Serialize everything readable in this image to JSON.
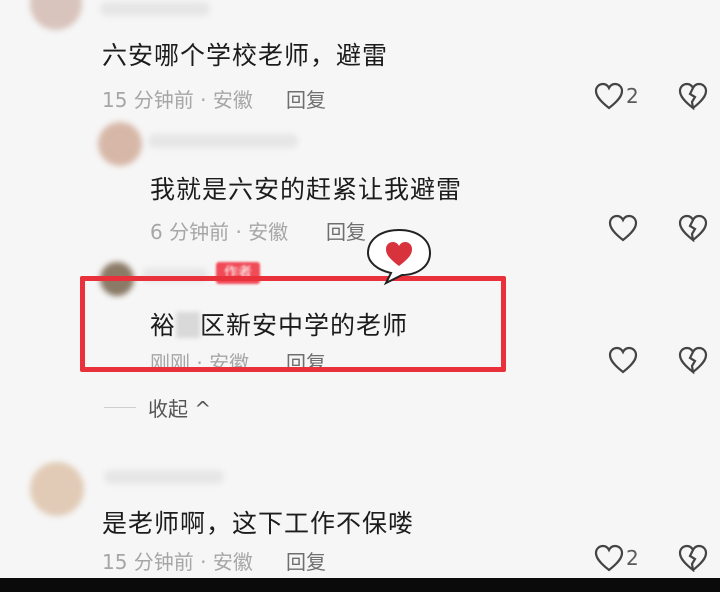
{
  "comments": [
    {
      "text": "六安哪个学校老师，避雷",
      "time": "15 分钟前 · 安徽",
      "reply": "回复",
      "likes": "2"
    },
    {
      "text": "我就是六安的赶紧让我避雷",
      "time": "6 分钟前 · 安徽",
      "reply": "回复",
      "likes": ""
    },
    {
      "text_prefix": "裕",
      "text_suffix": "区新安中学的老师",
      "author_badge": "作者",
      "time": "刚刚 · 安徽",
      "reply": "回复",
      "likes": ""
    },
    {
      "text": "是老师啊，这下工作不保喽",
      "time": "15 分钟前 · 安徽",
      "reply": "回复",
      "likes": "2"
    }
  ],
  "collapse_label": "收起 ^",
  "icons": {
    "like": "heart-outline-icon",
    "dislike": "broken-heart-icon",
    "reaction": "heart-speech-bubble-icon"
  },
  "colors": {
    "highlight": "#e8313b",
    "heart": "#d8323c"
  }
}
